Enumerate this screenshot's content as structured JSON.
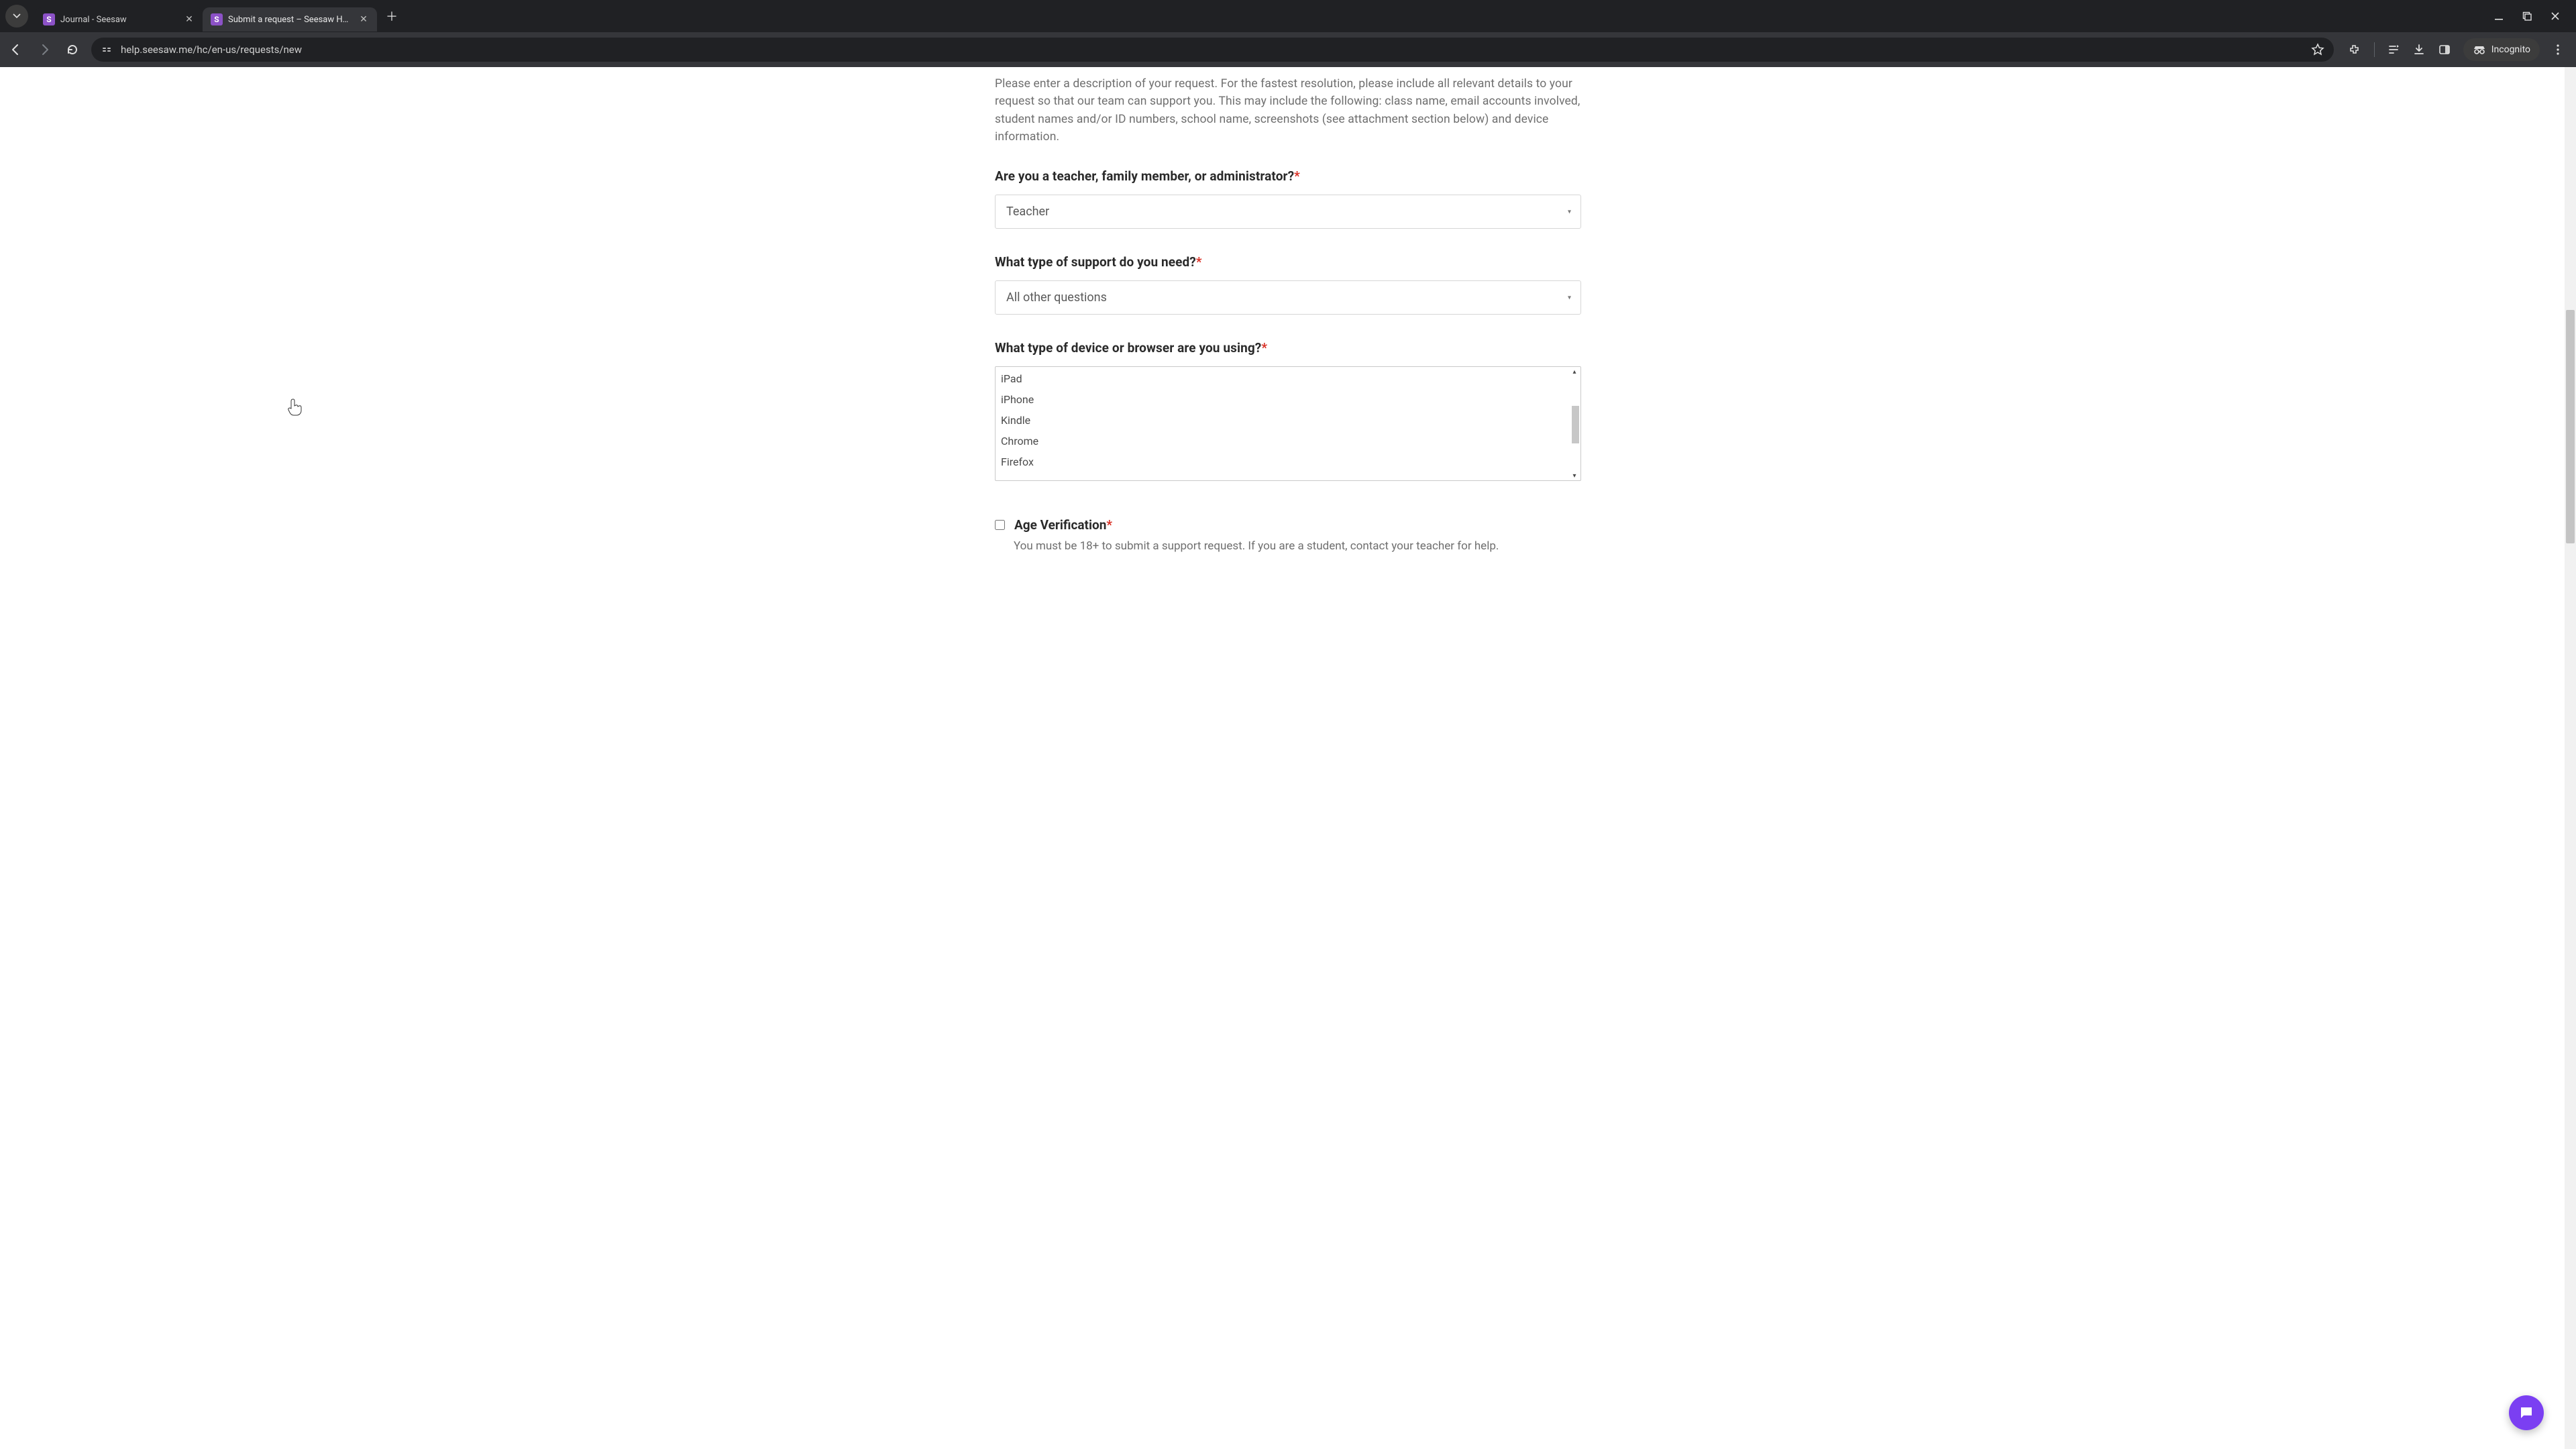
{
  "browser": {
    "tabs": [
      {
        "title": "Journal - Seesaw",
        "active": false
      },
      {
        "title": "Submit a request – Seesaw Help",
        "active": true
      }
    ],
    "url": "help.seesaw.me/hc/en-us/requests/new",
    "incognito_label": "Incognito"
  },
  "form": {
    "description_help": "Please enter a description of your request. For the fastest resolution, please include all relevant details to your request so that our team can support you. This may include the following: class name, email accounts involved, student names and/or ID numbers, school name, screenshots (see attachment section below) and device information.",
    "role": {
      "label": "Are you a teacher, family member, or administrator?",
      "value": "Teacher"
    },
    "support_type": {
      "label": "What type of support do you need?",
      "value": "All other questions"
    },
    "device": {
      "label": "What type of device or browser are you using?",
      "options": [
        "iPad",
        "iPhone",
        "Kindle",
        "Chrome",
        "Firefox"
      ]
    },
    "age": {
      "label": "Age Verification",
      "sub": "You must be 18+ to submit a support request. If you are a student, contact your teacher for help."
    }
  }
}
